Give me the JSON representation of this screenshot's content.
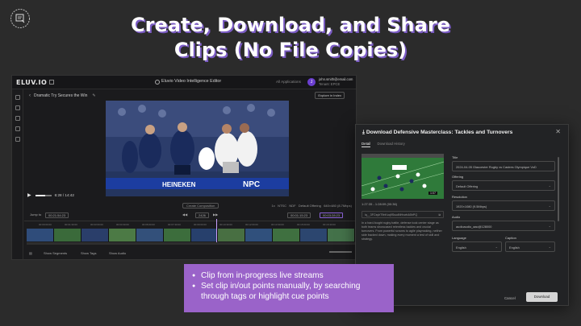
{
  "slide": {
    "title": "Create, Download, and Share Clips (No File Copies)",
    "bullets": [
      "Clip from in-progress live streams",
      "Set clip in/out points manually, by searching through tags or highlight cue points"
    ],
    "accent_color": "#9a63c9"
  },
  "editor": {
    "brand": "ELUV.IO",
    "app_title": "Eluvio Video Intelligence Editor",
    "all_applications": "All Applications",
    "user_initial": "J",
    "user_email": "john.smith@email.com",
    "tenant": "Tenant: EPCE",
    "stream_title": "Dramatic Try Secures the Win",
    "export_button": "Explore in Index",
    "timecode": "6:28 / 14:42",
    "create_composition": "Create Composition",
    "rate": "1x",
    "standard": "NTSC",
    "ndf": "NDF",
    "offering": "Default Offering",
    "resolution": "640×480 (8.7Mbps)",
    "jump_label": "Jump to",
    "jump_value": "00:21:54:23",
    "frame_value": "2426",
    "in_point": "00:01:15:23",
    "out_point": "00:03:28:23",
    "ticks": [
      "00:00:00:00",
      "00:01:30:00",
      "00:03:00:00",
      "00:04:30:00",
      "00:06:00:00",
      "00:07:30:00",
      "00:09:00:00",
      "00:10:30:00",
      "00:12:00:00",
      "00:13:30:00",
      "00:15:00:00",
      "00:16:30:00"
    ],
    "show_segments": "Show Segments",
    "show_tags": "Show Tags",
    "show_audio": "Show Audio"
  },
  "dialog": {
    "title": "Download Defensive Masterclass: Tackles and Turnovers",
    "tabs": [
      "Detail",
      "Download History"
    ],
    "duration_badge": "1:07",
    "range": "1:27:35 - 1:28:09 (00:36)",
    "content_id": "iq__3FCsyhT9nKoq9SsudNHvwhA5hPQ",
    "description": "In a hard-fought rugby battle, defense took center stage as both teams showcased relentless tackles and crucial turnovers. From powerful scrums to agile playmaking, neither side backed down, making every moment a test of skill and strategy.",
    "title_label": "Title",
    "title_value": "2024-04-05 Glaucester Rugby vs Castres Olympique VoD",
    "offering_label": "Offering",
    "offering_value": "Default Offering",
    "resolution_label": "Resolution",
    "resolution_value": "1920×1080 (9.5Mbps)",
    "audio_label": "Audio",
    "audio_value": "audioaudio_aac@128000",
    "language_label": "Language",
    "language_value": "English",
    "caption_label": "Caption",
    "caption_value": "English",
    "cancel": "Cancel",
    "download": "Download"
  }
}
